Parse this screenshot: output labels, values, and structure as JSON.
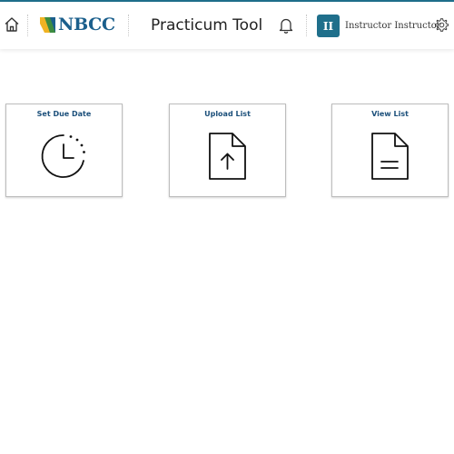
{
  "header": {
    "brand": "NBCC",
    "app_title": "Practicum Tool",
    "user_initials": "II",
    "user_name": "Instructor Instructor"
  },
  "cards": [
    {
      "title": "Set Due Date",
      "icon": "clock-icon"
    },
    {
      "title": "Upload List",
      "icon": "file-upload-icon"
    },
    {
      "title": "View List",
      "icon": "document-icon"
    }
  ],
  "colors": {
    "accent": "#1f6f8b",
    "card_title": "#1b4f7a",
    "logo_text": "#1b5f8c",
    "logo_yellow": "#f0b323",
    "logo_green": "#3d8c40"
  }
}
